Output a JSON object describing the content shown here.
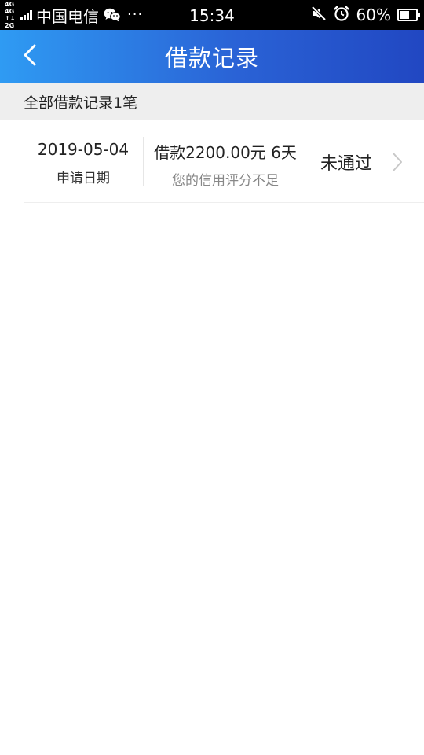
{
  "status_bar": {
    "net_top": "4G 4G",
    "net_bottom": "↑↓ 2G",
    "carrier": "中国电信",
    "dots": "···",
    "time": "15:34",
    "battery_percent": "60%",
    "battery_level": 0.6,
    "icons": [
      "wechat-icon",
      "mute-icon",
      "alarm-icon",
      "battery-icon"
    ]
  },
  "header": {
    "title": "借款记录",
    "back_icon": "chevron-left-icon",
    "gradient": [
      "#2f9bf3",
      "#2147c2"
    ]
  },
  "summary": {
    "text": "全部借款记录1笔"
  },
  "records": [
    {
      "date": "2019-05-04",
      "date_label": "申请日期",
      "description": "借款2200.00元 6天",
      "reason": "您的信用评分不足",
      "status": "未通过",
      "arrow_icon": "chevron-right-icon"
    }
  ],
  "colors": {
    "status_bar_bg": "#000000",
    "summary_bg": "#eeeeee",
    "muted_text": "#888888"
  }
}
